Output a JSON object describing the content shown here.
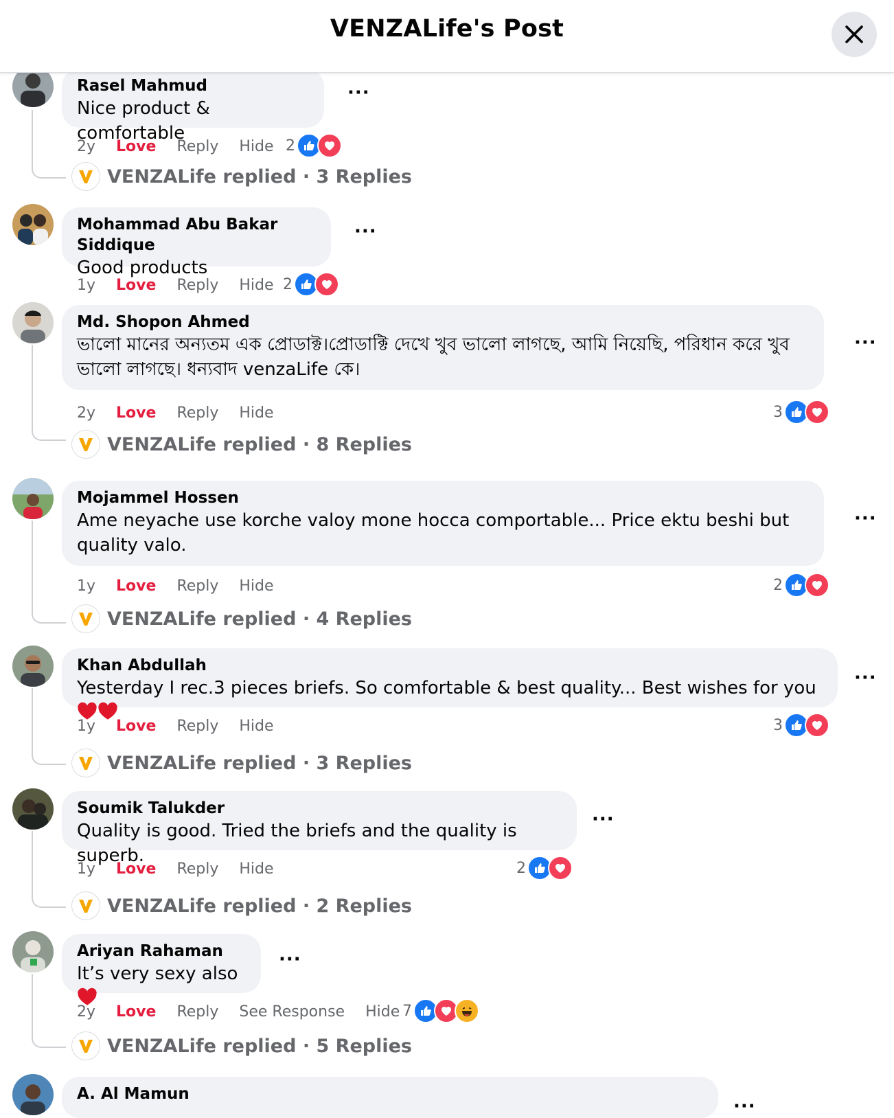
{
  "header": {
    "title": "VENZALife's Post"
  },
  "brand": {
    "reply_logo_color": "#f7a600",
    "like_color": "#1877f2",
    "love_color": "#e41e3f"
  },
  "comments": [
    {
      "author": "Rasel Mahmud",
      "text": "Nice product & comfortable",
      "time": "2y",
      "love": "Love",
      "reply": "Reply",
      "hide": "Hide",
      "reaction_count": "2",
      "replied_text": "VENZALife replied · 3 Replies"
    },
    {
      "author": "Mohammad Abu Bakar Siddique",
      "text": "Good products",
      "time": "1y",
      "love": "Love",
      "reply": "Reply",
      "hide": "Hide",
      "reaction_count": "2",
      "replied_text": ""
    },
    {
      "author": "Md. Shopon Ahmed",
      "text": "ভালো মানের অন্যতম এক প্রোডাক্ট।প্রোডাক্টি দেখে খুব ভালো লাগছে, আমি নিয়েছি, পরিধান করে খুব ভালো লাগছে। ধন্যবাদ venzaLife কে।",
      "time": "2y",
      "love": "Love",
      "reply": "Reply",
      "hide": "Hide",
      "reaction_count": "3",
      "replied_text": "VENZALife replied · 8 Replies"
    },
    {
      "author": "Mojammel Hossen",
      "text": "Ame neyache use korche valoy mone hocca comportable... Price ektu beshi but quality valo.",
      "time": "1y",
      "love": "Love",
      "reply": "Reply",
      "hide": "Hide",
      "reaction_count": "2",
      "replied_text": "VENZALife replied · 4 Replies"
    },
    {
      "author": "Khan Abdullah",
      "text": "Yesterday I rec.3 pieces briefs. So comfortable & best quality... Best wishes for you",
      "time": "1y",
      "love": "Love",
      "reply": "Reply",
      "hide": "Hide",
      "reaction_count": "3",
      "replied_text": "VENZALife replied · 3 Replies"
    },
    {
      "author": "Soumik Talukder",
      "text": "Quality is good. Tried the briefs and the quality is superb.",
      "time": "1y",
      "love": "Love",
      "reply": "Reply",
      "hide": "Hide",
      "reaction_count": "2",
      "replied_text": "VENZALife replied · 2 Replies"
    },
    {
      "author": "Ariyan Rahaman",
      "text": "It’s very sexy also",
      "time": "2y",
      "love": "Love",
      "reply": "Reply",
      "see_response": "See Response",
      "hide": "Hide",
      "reaction_count": "7",
      "replied_text": "VENZALife replied · 5 Replies"
    },
    {
      "author": "A. Al Mamun"
    }
  ]
}
